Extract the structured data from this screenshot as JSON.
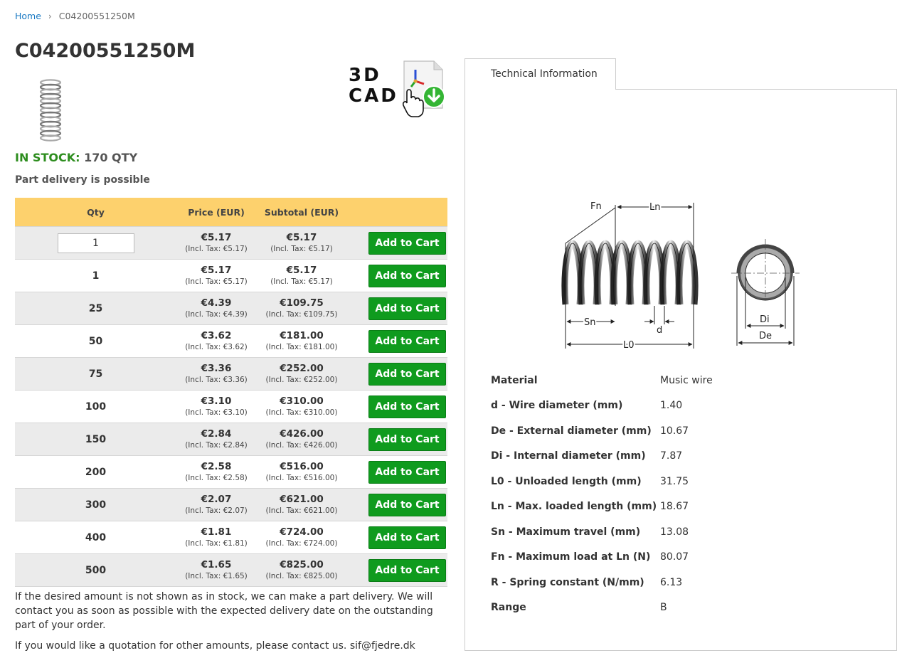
{
  "breadcrumb": {
    "home": "Home",
    "current": "C04200551250M"
  },
  "product": {
    "title": "C04200551250M",
    "stock_label": "IN STOCK:",
    "stock_value": "170 QTY",
    "part_delivery": "Part delivery is possible",
    "cad_line1": "3D",
    "cad_line2": "CAD"
  },
  "table": {
    "headers": {
      "qty": "Qty",
      "price": "Price (EUR)",
      "subtotal": "Subtotal (EUR)"
    },
    "input_value": "1",
    "input_price": "€5.17",
    "input_price_tax": "(Incl. Tax: €5.17)",
    "input_sub": "€5.17",
    "input_sub_tax": "(Incl. Tax: €5.17)",
    "button_label": "Add to Cart",
    "rows": [
      {
        "qty": "1",
        "price": "€5.17",
        "price_tax": "(Incl. Tax: €5.17)",
        "sub": "€5.17",
        "sub_tax": "(Incl. Tax: €5.17)"
      },
      {
        "qty": "25",
        "price": "€4.39",
        "price_tax": "(Incl. Tax: €4.39)",
        "sub": "€109.75",
        "sub_tax": "(Incl. Tax: €109.75)"
      },
      {
        "qty": "50",
        "price": "€3.62",
        "price_tax": "(Incl. Tax: €3.62)",
        "sub": "€181.00",
        "sub_tax": "(Incl. Tax: €181.00)"
      },
      {
        "qty": "75",
        "price": "€3.36",
        "price_tax": "(Incl. Tax: €3.36)",
        "sub": "€252.00",
        "sub_tax": "(Incl. Tax: €252.00)"
      },
      {
        "qty": "100",
        "price": "€3.10",
        "price_tax": "(Incl. Tax: €3.10)",
        "sub": "€310.00",
        "sub_tax": "(Incl. Tax: €310.00)"
      },
      {
        "qty": "150",
        "price": "€2.84",
        "price_tax": "(Incl. Tax: €2.84)",
        "sub": "€426.00",
        "sub_tax": "(Incl. Tax: €426.00)"
      },
      {
        "qty": "200",
        "price": "€2.58",
        "price_tax": "(Incl. Tax: €2.58)",
        "sub": "€516.00",
        "sub_tax": "(Incl. Tax: €516.00)"
      },
      {
        "qty": "300",
        "price": "€2.07",
        "price_tax": "(Incl. Tax: €2.07)",
        "sub": "€621.00",
        "sub_tax": "(Incl. Tax: €621.00)"
      },
      {
        "qty": "400",
        "price": "€1.81",
        "price_tax": "(Incl. Tax: €1.81)",
        "sub": "€724.00",
        "sub_tax": "(Incl. Tax: €724.00)"
      },
      {
        "qty": "500",
        "price": "€1.65",
        "price_tax": "(Incl. Tax: €1.65)",
        "sub": "€825.00",
        "sub_tax": "(Incl. Tax: €825.00)"
      }
    ]
  },
  "notes": {
    "part_delivery_text": "If the desired amount is not shown as in stock, we can make a part delivery. We will contact you as soon as possible with the expected delivery date on the outstanding part of your order.",
    "quotation_text": "If you would like a quotation for other amounts, please contact us. sif@fjedre.dk"
  },
  "tech": {
    "tab_label": "Technical Information",
    "diagram_labels": {
      "fn": "Fn",
      "ln": "Ln",
      "sn": "Sn",
      "d": "d",
      "l0": "L0",
      "di": "Di",
      "de": "De"
    },
    "specs": [
      {
        "key": "Material",
        "value": "Music wire"
      },
      {
        "key": "d - Wire diameter (mm)",
        "value": "1.40"
      },
      {
        "key": "De - External diameter (mm)",
        "value": "10.67"
      },
      {
        "key": "Di - Internal diameter (mm)",
        "value": "7.87"
      },
      {
        "key": "L0 - Unloaded length (mm)",
        "value": "31.75"
      },
      {
        "key": "Ln - Max. loaded length (mm)",
        "value": "18.67"
      },
      {
        "key": "Sn - Maximum travel (mm)",
        "value": "13.08"
      },
      {
        "key": "Fn - Maximum load at Ln (N)",
        "value": "80.07"
      },
      {
        "key": "R - Spring constant (N/mm)",
        "value": "6.13"
      },
      {
        "key": "Range",
        "value": "B"
      }
    ]
  }
}
